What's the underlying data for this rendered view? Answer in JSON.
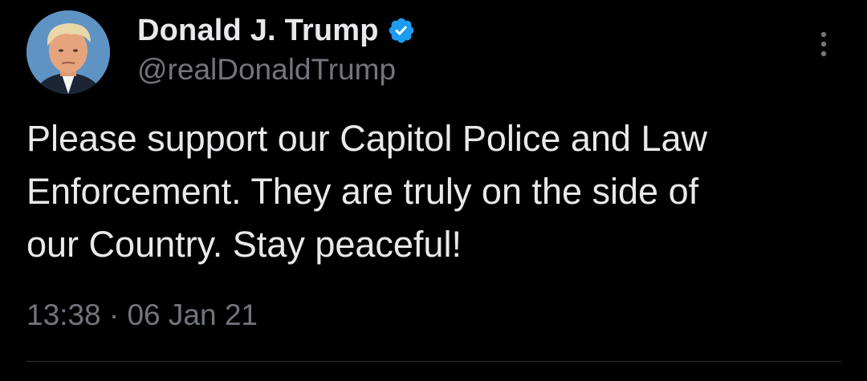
{
  "author": {
    "display_name": "Donald J. Trump",
    "handle": "@realDonaldTrump",
    "verified": true,
    "verified_color": "#1d9bf0"
  },
  "tweet": {
    "lines": [
      "Please support our Capitol Police and Law",
      "Enforcement. They are truly on the side of",
      "our Country. Stay peaceful!"
    ],
    "time": "13:38",
    "separator": "·",
    "date": "06 Jan 21"
  },
  "icons": {
    "more": "more-vertical-icon",
    "verified": "verified-badge-icon"
  },
  "colors": {
    "background": "#000000",
    "primary_text": "#e7e9ea",
    "secondary_text": "#71767b"
  }
}
